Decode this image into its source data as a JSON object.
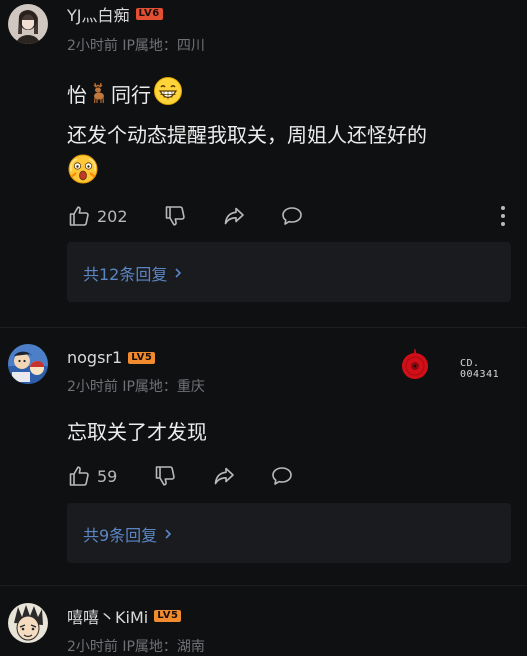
{
  "comments": [
    {
      "username": "YJ灬白痴",
      "level": "LV6",
      "meta": "2小时前 IP属地：四川",
      "line1_pre": "怡",
      "line1_post": "同行",
      "line2": "还发个动态提醒我取关，周姐人还怪好的",
      "likes": "202",
      "replies": "共12条回复"
    },
    {
      "username": "nogsr1",
      "level": "LV5",
      "meta": "2小时前 IP属地：重庆",
      "text": "忘取关了才发现",
      "likes": "59",
      "replies": "共9条回复"
    },
    {
      "username": "嘻嘻丶KiMi",
      "level": "LV5",
      "meta": "2小时前 IP属地：湖南"
    }
  ],
  "decoration": {
    "cd_line1": "CD.",
    "cd_line2": "004341"
  },
  "colors": {
    "background": "#0f1012",
    "lv6_badge": "#e24f32",
    "lv5_badge": "#f28a2e",
    "link": "#5b86c4",
    "reply_box": "#1a1b1f",
    "record_red": "#d10f18"
  },
  "icons": [
    "thumbs-up-icon",
    "thumbs-down-icon",
    "share-icon",
    "comment-icon",
    "more-icon",
    "chevron-right-icon",
    "deer-emoji",
    "grin-emoji",
    "scared-emoji"
  ]
}
